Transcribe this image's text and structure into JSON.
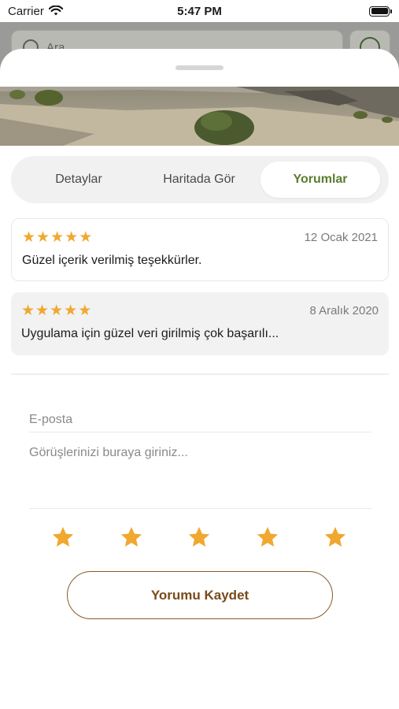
{
  "status_bar": {
    "carrier": "Carrier",
    "time": "5:47 PM"
  },
  "background_search": {
    "text": "Ara..."
  },
  "tabs": [
    {
      "label": "Detaylar"
    },
    {
      "label": "Haritada Gör"
    },
    {
      "label": "Yorumlar"
    }
  ],
  "active_tab": "Yorumlar",
  "reviews": [
    {
      "rating": 5,
      "date": "12 Ocak 2021",
      "text": "Güzel içerik verilmiş teşekkürler."
    },
    {
      "rating": 5,
      "date": "8 Aralık 2020",
      "text": "Uygulama için güzel veri girilmiş çok başarılı..."
    }
  ],
  "form": {
    "email_placeholder": "E-posta",
    "comment_placeholder": "Görüşlerinizi buraya giriniz...",
    "rating_value": 5,
    "save_label": "Yorumu Kaydet"
  },
  "colors": {
    "accent_green": "#5a7d2f",
    "star": "#f0a830",
    "button_brown": "#7a4a1a"
  },
  "icons": [
    "wifi-icon",
    "battery-icon",
    "search-icon",
    "filter-icon",
    "star-icon"
  ]
}
